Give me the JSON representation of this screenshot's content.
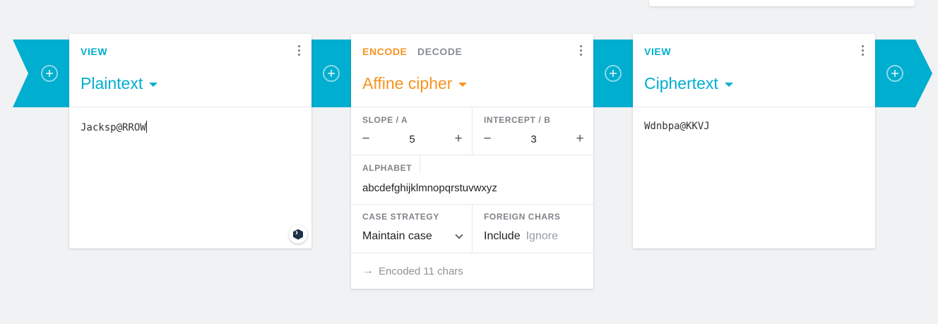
{
  "pipeline": {
    "add_button_label": "Add"
  },
  "plaintext_card": {
    "mode": "VIEW",
    "title": "Plaintext",
    "content": "Jacksp@RROW"
  },
  "cipher_card": {
    "mode_active": "ENCODE",
    "mode_inactive": "DECODE",
    "title": "Affine cipher",
    "slope": {
      "label": "SLOPE / A",
      "value": "5",
      "minus": "−",
      "plus": "+"
    },
    "intercept": {
      "label": "INTERCEPT / B",
      "value": "3",
      "minus": "−",
      "plus": "+"
    },
    "alphabet": {
      "label": "ALPHABET",
      "value": "abcdefghijklmnopqrstuvwxyz"
    },
    "case_strategy": {
      "label": "CASE STRATEGY",
      "value": "Maintain case"
    },
    "foreign_chars": {
      "label": "FOREIGN CHARS",
      "options": [
        "Include",
        "Ignore"
      ],
      "selected": "Include"
    },
    "status": {
      "arrow": "→",
      "text": "Encoded 11 chars"
    }
  },
  "ciphertext_card": {
    "mode": "VIEW",
    "title": "Ciphertext",
    "content": "Wdnbpa@KKVJ"
  },
  "colors": {
    "accent_blue": "#00aecf",
    "accent_orange": "#f7931e",
    "background": "#f1f2f4"
  },
  "icons": [
    "add-icon",
    "more-vert-icon",
    "dropdown-caret-icon",
    "chevron-down-icon",
    "arrow-right-icon",
    "extension-badge-icon"
  ]
}
